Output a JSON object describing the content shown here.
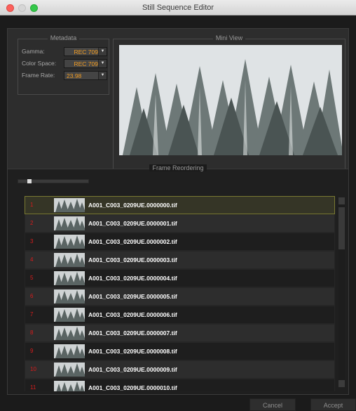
{
  "window": {
    "title": "Still Sequence Editor"
  },
  "metadata": {
    "title": "Metadata",
    "fields": [
      {
        "label": "Gamma:",
        "value": "REC 709"
      },
      {
        "label": "Color Space:",
        "value": "REC 709"
      },
      {
        "label": "Frame Rate:",
        "value": "23.98"
      }
    ]
  },
  "mini_view": {
    "title": "Mini View"
  },
  "frame_reordering": {
    "title": "Frame Reordering",
    "rows": [
      {
        "num": "1",
        "name": "A001_C003_0209UE.0000000.tif"
      },
      {
        "num": "2",
        "name": "A001_C003_0209UE.0000001.tif"
      },
      {
        "num": "3",
        "name": "A001_C003_0209UE.0000002.tif"
      },
      {
        "num": "4",
        "name": "A001_C003_0209UE.0000003.tif"
      },
      {
        "num": "5",
        "name": "A001_C003_0209UE.0000004.tif"
      },
      {
        "num": "6",
        "name": "A001_C003_0209UE.0000005.tif"
      },
      {
        "num": "7",
        "name": "A001_C003_0209UE.0000006.tif"
      },
      {
        "num": "8",
        "name": "A001_C003_0209UE.0000007.tif"
      },
      {
        "num": "9",
        "name": "A001_C003_0209UE.0000008.tif"
      },
      {
        "num": "10",
        "name": "A001_C003_0209UE.0000009.tif"
      },
      {
        "num": "11",
        "name": "A001_C003_0209UE.0000010.tif"
      }
    ]
  },
  "buttons": {
    "cancel": "Cancel",
    "accept": "Accept"
  },
  "colors": {
    "accent_orange": "#f29c21",
    "frame_number_red": "#d81c1c",
    "selected_border": "#7a7a32"
  }
}
